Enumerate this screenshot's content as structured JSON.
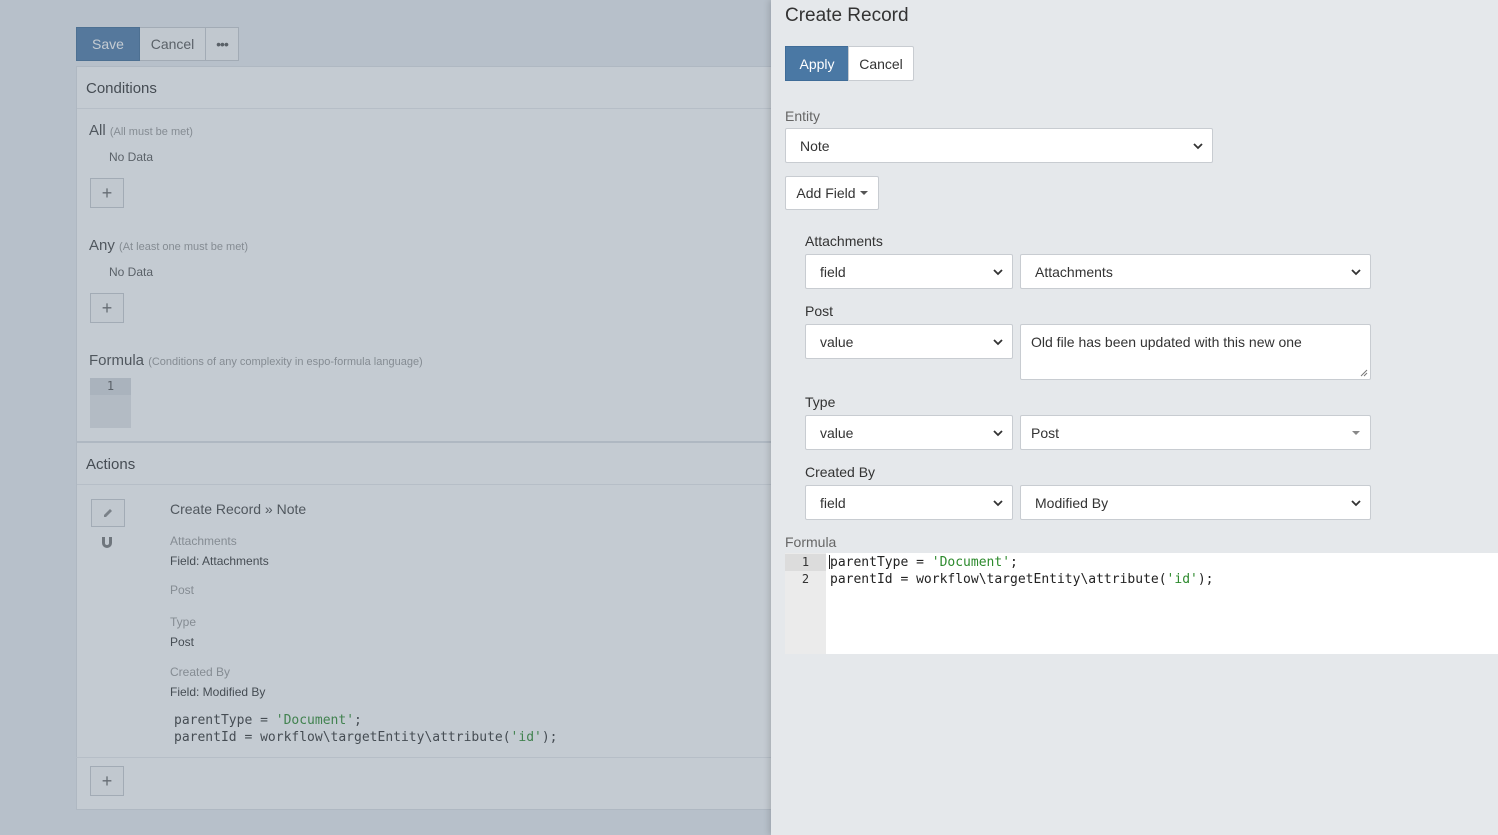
{
  "background": {
    "toolbar": {
      "save_label": "Save",
      "cancel_label": "Cancel",
      "more_label": "•••"
    },
    "conditions": {
      "header": "Conditions",
      "all_label": "All",
      "all_hint": "(All must be met)",
      "all_empty": "No Data",
      "any_label": "Any",
      "any_hint": "(At least one must be met)",
      "any_empty": "No Data",
      "formula_label": "Formula",
      "formula_hint": "(Conditions of any complexity in espo-formula language)",
      "formula_line": "1"
    },
    "actions": {
      "header": "Actions",
      "action_title": "Create Record » Note",
      "fields": [
        {
          "label": "Attachments",
          "value": "Field: Attachments"
        },
        {
          "label": "Post",
          "value": ""
        },
        {
          "label": "Type",
          "value": "Post"
        },
        {
          "label": "Created By",
          "value": "Field: Modified By"
        }
      ],
      "code": {
        "line1_a": "parentType = ",
        "line1_str": "'Document'",
        "line1_b": ";",
        "line2_a": "parentId = workflow\\targetEntity\\attribute(",
        "line2_str": "'id'",
        "line2_b": ");"
      }
    }
  },
  "modal": {
    "title": "Create Record",
    "apply_label": "Apply",
    "cancel_label": "Cancel",
    "entity": {
      "label": "Entity",
      "value": "Note"
    },
    "add_field_label": "Add Field",
    "fields": {
      "attachments": {
        "label": "Attachments",
        "type": "field",
        "value": "Attachments"
      },
      "post": {
        "label": "Post",
        "type": "value",
        "value": "Old file has been updated with this new one"
      },
      "type": {
        "label": "Type",
        "type": "value",
        "value": "Post"
      },
      "created_by": {
        "label": "Created By",
        "type": "field",
        "value": "Modified By"
      }
    },
    "formula": {
      "label": "Formula",
      "line_numbers": [
        "1",
        "2"
      ],
      "line1_a": "parentType = ",
      "line1_str": "'Document'",
      "line1_b": ";",
      "line2_a": "parentId = workflow\\targetEntity\\attribute(",
      "line2_str": "'id'",
      "line2_b": ");"
    }
  },
  "colors": {
    "primary": "#4a78a4",
    "string": "#2d8a2d",
    "panel_bg": "#e5e8eb"
  }
}
